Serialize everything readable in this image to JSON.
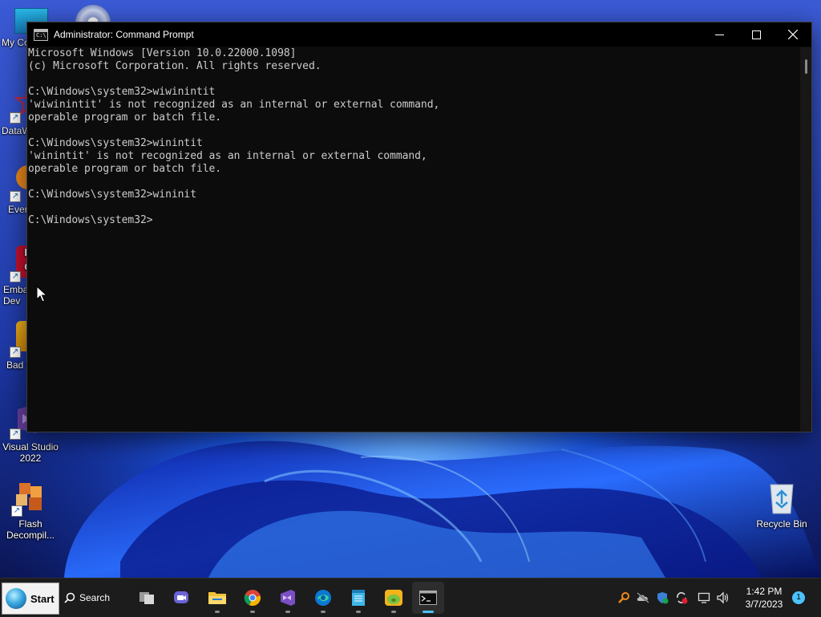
{
  "desktop": {
    "icons_left": [
      {
        "label": "My Co",
        "icon": "computer-icon"
      },
      {
        "label": "DataW",
        "icon": "datawatch-icon"
      },
      {
        "label": "Ever",
        "icon": "everything-icon"
      },
      {
        "label": "Emba\nDev",
        "icon": "embarcadero-icon"
      },
      {
        "label": "Bad P",
        "icon": "bad-piggies-icon"
      },
      {
        "label": "Visual Studio\n2022",
        "icon": "visual-studio-icon"
      },
      {
        "label": "Flash\nDecompil...",
        "icon": "flash-decompiler-icon"
      }
    ],
    "recycle_bin": {
      "label": "Recycle Bin",
      "icon": "recycle-bin-icon"
    }
  },
  "window": {
    "title": "Administrator: Command Prompt",
    "console_lines": [
      "Microsoft Windows [Version 10.0.22000.1098]",
      "(c) Microsoft Corporation. All rights reserved.",
      "",
      "C:\\Windows\\system32>wiwinintit",
      "'wiwinintit' is not recognized as an internal or external command,",
      "operable program or batch file.",
      "",
      "C:\\Windows\\system32>winintit",
      "'winintit' is not recognized as an internal or external command,",
      "operable program or batch file.",
      "",
      "C:\\Windows\\system32>wininit",
      "",
      "C:\\Windows\\system32>"
    ]
  },
  "taskbar": {
    "start_label": "Start",
    "search_label": "Search",
    "apps": [
      {
        "name": "task-view",
        "icon": "task-view-icon",
        "active": false
      },
      {
        "name": "teams-chat",
        "icon": "chat-icon",
        "active": false
      },
      {
        "name": "file-explorer",
        "icon": "folder-icon",
        "active": false
      },
      {
        "name": "chrome",
        "icon": "chrome-icon",
        "active": false
      },
      {
        "name": "visual-studio",
        "icon": "visual-studio-icon",
        "active": false
      },
      {
        "name": "edge",
        "icon": "edge-icon",
        "active": false
      },
      {
        "name": "notepad",
        "icon": "notepad-icon",
        "active": false
      },
      {
        "name": "bad-piggies",
        "icon": "bad-piggies-icon",
        "active": false
      },
      {
        "name": "command-prompt",
        "icon": "cmd-icon",
        "active": true
      }
    ],
    "tray": [
      "search-tool-icon",
      "onedrive-icon",
      "defender-icon",
      "sync-icon",
      "network-icon",
      "volume-icon"
    ],
    "clock_time": "1:42 PM",
    "clock_date": "3/7/2023",
    "notification_count": "1"
  },
  "colors": {
    "console_bg": "#0c0c0c",
    "console_text": "#cccccc",
    "taskbar_bg": "#1c1c1c",
    "accent": "#4cc2ff"
  }
}
